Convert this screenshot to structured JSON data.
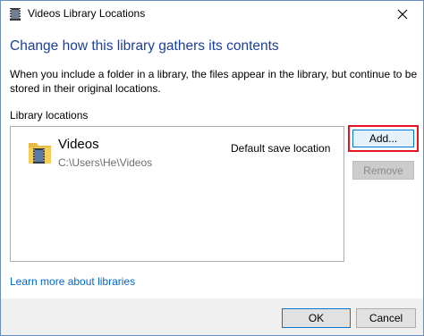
{
  "window": {
    "title": "Videos Library Locations"
  },
  "dialog": {
    "heading": "Change how this library gathers its contents",
    "description": "When you include a folder in a library, the files appear in the library, but continue to be stored in their original locations.",
    "section_label": "Library locations",
    "locations": [
      {
        "name": "Videos",
        "path": "C:\\Users\\He\\Videos",
        "status": "Default save location",
        "icon": "videos-folder-icon"
      }
    ],
    "add_label": "Add...",
    "remove_label": "Remove",
    "learn_more": "Learn more about libraries",
    "ok_label": "OK",
    "cancel_label": "Cancel"
  },
  "colors": {
    "heading": "#1a3e9a",
    "link": "#0066cc",
    "highlight": "#e81123",
    "focus": "#0078d7"
  }
}
